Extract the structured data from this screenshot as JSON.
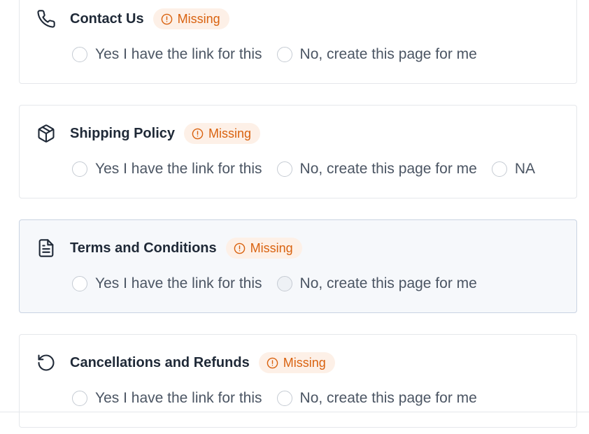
{
  "sections": [
    {
      "title": "Contact Us",
      "icon": "phone-icon",
      "badge": "Missing",
      "options": [
        "Yes I have the link for this",
        "No, create this page for me"
      ]
    },
    {
      "title": "Shipping Policy",
      "icon": "package-icon",
      "badge": "Missing",
      "options": [
        "Yes I have the link for this",
        "No, create this page for me",
        "NA"
      ]
    },
    {
      "title": "Terms and Conditions",
      "icon": "document-icon",
      "badge": "Missing",
      "options": [
        "Yes I have the link for this",
        "No, create this page for me"
      ]
    },
    {
      "title": "Cancellations and Refunds",
      "icon": "rotate-ccw-icon",
      "badge": "Missing",
      "options": [
        "Yes I have the link for this",
        "No, create this page for me"
      ]
    }
  ],
  "colors": {
    "badge_bg": "#fdf0e7",
    "badge_text": "#d9620f",
    "title_text": "#1f2937",
    "option_text": "#4b5563"
  }
}
